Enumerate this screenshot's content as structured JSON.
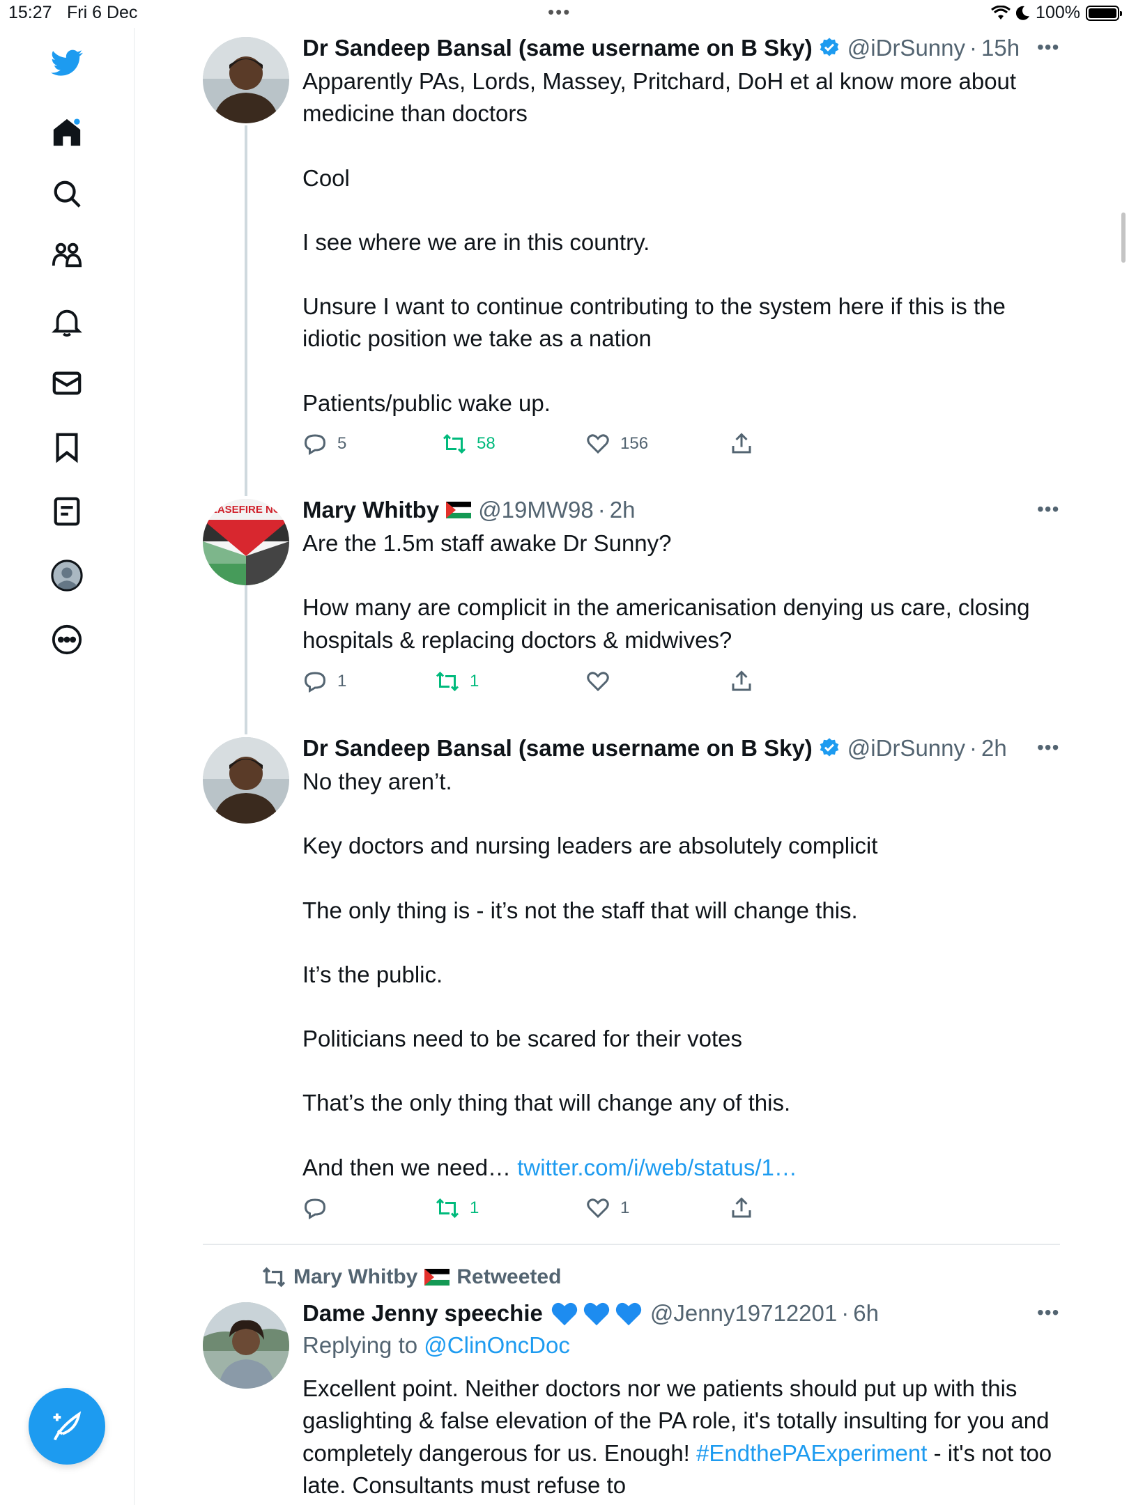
{
  "status_bar": {
    "time": "15:27",
    "date": "Fri 6 Dec",
    "battery": "100%"
  },
  "sidebar": {
    "items": [
      {
        "icon": "twitter-bird-icon"
      },
      {
        "icon": "home-icon"
      },
      {
        "icon": "search-icon"
      },
      {
        "icon": "communities-icon"
      },
      {
        "icon": "notifications-bell-icon"
      },
      {
        "icon": "messages-envelope-icon"
      },
      {
        "icon": "bookmark-icon"
      },
      {
        "icon": "lists-icon"
      },
      {
        "icon": "profile-icon"
      },
      {
        "icon": "more-circle-icon"
      }
    ],
    "compose_icon": "compose-feather-icon"
  },
  "colors": {
    "accent": "#1d9bf0",
    "retweet": "#00ba7c",
    "muted": "#536471"
  },
  "tweets": [
    {
      "name": "Dr Sandeep Bansal (same username on B Sky)",
      "handle": "@iDrSunny",
      "time": "15h",
      "body": [
        "Apparently PAs, Lords, Massey, Pritchard, DoH et al know more about medicine than doctors",
        "Cool",
        "I see where we are in this country.",
        "Unsure I want to continue contributing to the system here if this is the idiotic position we take as a nation",
        "Patients/public wake up."
      ],
      "replies": "5",
      "retweets": "58",
      "likes": "156"
    },
    {
      "name": "Mary Whitby",
      "handle": "@19MW98",
      "time": "2h",
      "avatar_text": "CEASEFIRE NOW",
      "body": [
        "Are the 1.5m staff awake Dr Sunny?",
        "How many are complicit in the americanisation denying us care, closing hospitals & replacing doctors & midwives?"
      ],
      "replies": "1",
      "retweets": "1",
      "likes": ""
    },
    {
      "name": "Dr Sandeep Bansal (same username on B Sky)",
      "handle": "@iDrSunny",
      "time": "2h",
      "body": [
        "No they aren’t.",
        "Key doctors and nursing leaders are absolutely complicit",
        "The only thing is - it’s not the staff that will change this.",
        "It’s the public.",
        "Politicians need to be scared for their votes",
        "That’s the only thing that will change any of this."
      ],
      "last_line": "And then we need…",
      "link": "twitter.com/i/web/status/1…",
      "replies": "",
      "retweets": "1",
      "likes": "1"
    },
    {
      "retweeted_by": "Mary Whitby",
      "retweeted_label": "Retweeted",
      "name": "Dame Jenny speechie",
      "handle": "@Jenny19712201",
      "time": "6h",
      "replying_prefix": "Replying to",
      "replying_to": "@ClinOncDoc",
      "body": "Excellent point. Neither doctors nor we patients should put up with this gaslighting & false elevation of the PA role, it's totally insulting for you and completely dangerous for us. Enough!",
      "hashtag": "#EndthePAExperiment",
      "body_after": " - it's not too late. Consultants must refuse to"
    }
  ]
}
